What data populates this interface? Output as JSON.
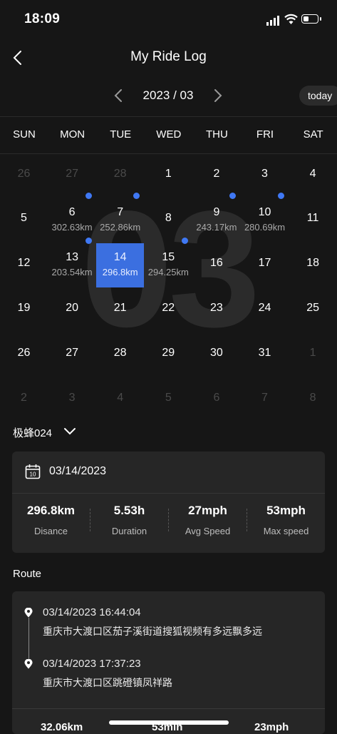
{
  "status": {
    "time": "18:09"
  },
  "header": {
    "title": "My Ride Log"
  },
  "month": {
    "label": "2023 / 03",
    "today_label": "today",
    "watermark": "03"
  },
  "weekdays": [
    "SUN",
    "MON",
    "TUE",
    "WED",
    "THU",
    "FRI",
    "SAT"
  ],
  "calendar": {
    "rows": [
      [
        {
          "d": "26",
          "dim": true
        },
        {
          "d": "27",
          "dim": true
        },
        {
          "d": "28",
          "dim": true
        },
        {
          "d": "1"
        },
        {
          "d": "2"
        },
        {
          "d": "3"
        },
        {
          "d": "4"
        }
      ],
      [
        {
          "d": "5"
        },
        {
          "d": "6",
          "km": "302.63km",
          "dot": true
        },
        {
          "d": "7",
          "km": "252.86km",
          "dot": true
        },
        {
          "d": "8"
        },
        {
          "d": "9",
          "km": "243.17km",
          "dot": true
        },
        {
          "d": "10",
          "km": "280.69km",
          "dot": true
        },
        {
          "d": "11"
        }
      ],
      [
        {
          "d": "12"
        },
        {
          "d": "13",
          "km": "203.54km",
          "dot": true
        },
        {
          "d": "14",
          "km": "296.8km",
          "selected": true
        },
        {
          "d": "15",
          "km": "294.25km",
          "dot": true
        },
        {
          "d": "16"
        },
        {
          "d": "17"
        },
        {
          "d": "18"
        }
      ],
      [
        {
          "d": "19"
        },
        {
          "d": "20"
        },
        {
          "d": "21"
        },
        {
          "d": "22"
        },
        {
          "d": "23"
        },
        {
          "d": "24"
        },
        {
          "d": "25"
        }
      ],
      [
        {
          "d": "26"
        },
        {
          "d": "27"
        },
        {
          "d": "28"
        },
        {
          "d": "29"
        },
        {
          "d": "30"
        },
        {
          "d": "31"
        },
        {
          "d": "1",
          "dim": true
        }
      ],
      [
        {
          "d": "2",
          "dim": true
        },
        {
          "d": "3",
          "dim": true
        },
        {
          "d": "4",
          "dim": true
        },
        {
          "d": "5",
          "dim": true
        },
        {
          "d": "6",
          "dim": true
        },
        {
          "d": "7",
          "dim": true
        },
        {
          "d": "8",
          "dim": true
        }
      ]
    ]
  },
  "vehicle": {
    "name": "极蜂024"
  },
  "summary": {
    "date": "03/14/2023",
    "stats": [
      {
        "value": "296.8km",
        "label": "Disance"
      },
      {
        "value": "5.53h",
        "label": "Duration"
      },
      {
        "value": "27mph",
        "label": "Avg Speed"
      },
      {
        "value": "53mph",
        "label": "Max speed"
      }
    ]
  },
  "route": {
    "title": "Route",
    "start": {
      "time": "03/14/2023 16:44:04",
      "address": "重庆市大渡口区茄子溪街道搜狐视频有多远飘多远"
    },
    "end": {
      "time": "03/14/2023 17:37:23",
      "address": "重庆市大渡口区跳磴镇凤祥路"
    },
    "bottom_stats": [
      "32.06km",
      "53min",
      "23mph"
    ]
  },
  "colors": {
    "accent": "#3b6fe0",
    "dot": "#3f78f4",
    "background": "#161616",
    "card": "#262626"
  }
}
